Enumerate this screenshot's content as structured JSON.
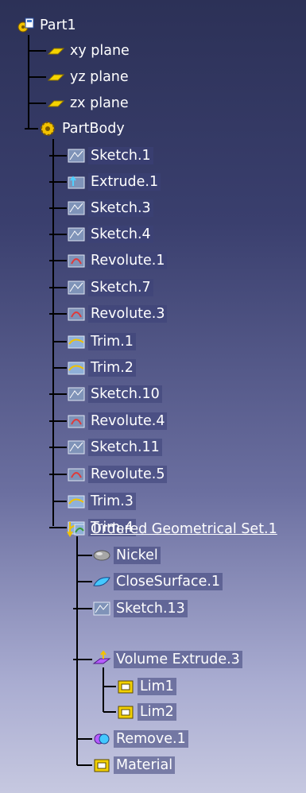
{
  "tree": {
    "root_label": "Part1",
    "planes": [
      "xy plane",
      "yz plane",
      "zx plane"
    ],
    "body_label": "PartBody",
    "body_items": [
      {
        "label": "Sketch.1",
        "icon": "sketch-icon",
        "expandable": true
      },
      {
        "label": "Extrude.1",
        "icon": "extrude-icon",
        "expandable": true
      },
      {
        "label": "Sketch.3",
        "icon": "sketch-icon",
        "expandable": true
      },
      {
        "label": "Sketch.4",
        "icon": "sketch-icon",
        "expandable": true
      },
      {
        "label": "Revolute.1",
        "icon": "revolute-icon",
        "expandable": true
      },
      {
        "label": "Sketch.7",
        "icon": "sketch-icon",
        "expandable": true
      },
      {
        "label": "Revolute.3",
        "icon": "revolute-icon",
        "expandable": true
      },
      {
        "label": "Trim.1",
        "icon": "trim-icon",
        "expandable": false
      },
      {
        "label": "Trim.2",
        "icon": "trim-icon",
        "expandable": false
      },
      {
        "label": "Sketch.10",
        "icon": "sketch-icon",
        "expandable": true
      },
      {
        "label": "Revolute.4",
        "icon": "revolute-icon",
        "expandable": true
      },
      {
        "label": "Sketch.11",
        "icon": "sketch-icon",
        "expandable": true
      },
      {
        "label": "Revolute.5",
        "icon": "revolute-icon",
        "expandable": true
      },
      {
        "label": "Trim.3",
        "icon": "trim-icon",
        "expandable": false
      },
      {
        "label": "Trim.4",
        "icon": "trim-icon",
        "expandable": false
      }
    ],
    "ogs_label": "Ordered Geometrical Set.1",
    "ogs_items": [
      {
        "label": "Nickel",
        "icon": "nickel-sphere-icon"
      },
      {
        "label": "CloseSurface.1",
        "icon": "close-surface-icon"
      },
      {
        "label": "Sketch.13",
        "icon": "sketch-icon"
      },
      {
        "label": "Volume Extrude.3",
        "icon": "volume-extrude-icon"
      },
      {
        "label": "Lim1",
        "icon": "limit-box-icon"
      },
      {
        "label": "Lim2",
        "icon": "limit-box-icon"
      },
      {
        "label": "Remove.1",
        "icon": "remove-icon"
      },
      {
        "label": "Material",
        "icon": "material-box-icon"
      }
    ]
  }
}
